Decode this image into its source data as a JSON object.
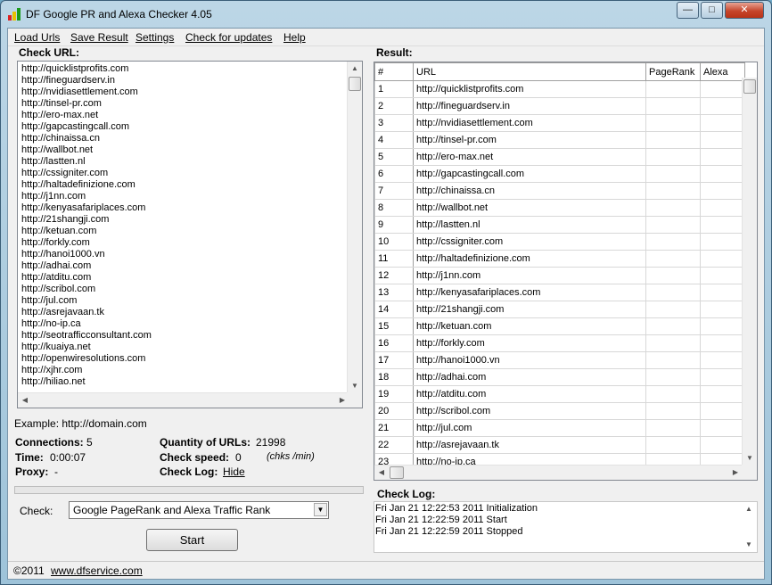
{
  "window": {
    "title": "DF Google PR and Alexa Checker 4.05"
  },
  "menu": [
    {
      "label": "Load Urls"
    },
    {
      "label": "Save Result"
    },
    {
      "label": "Settings"
    },
    {
      "label": "Check for updates"
    },
    {
      "label": "Help"
    }
  ],
  "check_url": {
    "label": "Check URL:",
    "urls": [
      "http://quicklistprofits.com",
      "http://fineguardserv.in",
      "http://nvidiasettlement.com",
      "http://tinsel-pr.com",
      "http://ero-max.net",
      "http://gapcastingcall.com",
      "http://chinaissa.cn",
      "http://wallbot.net",
      "http://lastten.nl",
      "http://cssigniter.com",
      "http://haltadefinizione.com",
      "http://j1nn.com",
      "http://kenyasafariplaces.com",
      "http://21shangji.com",
      "http://ketuan.com",
      "http://forkly.com",
      "http://hanoi1000.vn",
      "http://adhai.com",
      "http://atditu.com",
      "http://scribol.com",
      "http://jul.com",
      "http://asrejavaan.tk",
      "http://no-ip.ca",
      "http://seotrafficconsultant.com",
      "http://kuaiya.net",
      "http://openwiresolutions.com",
      "http://xjhr.com",
      "http://hiliao.net"
    ],
    "example": "Example: http://domain.com"
  },
  "stats": {
    "connections_label": "Connections:",
    "connections_value": "5",
    "time_label": "Time:",
    "time_value": "0:00:07",
    "proxy_label": "Proxy:",
    "proxy_value": "-",
    "quantity_label": "Quantity of URLs:",
    "quantity_value": "21998",
    "speed_label": "Check speed:",
    "speed_value": "0",
    "speed_unit": "(chks /min)",
    "log_label": "Check Log:",
    "log_link": "Hide"
  },
  "check": {
    "label": "Check:",
    "selected": "Google PageRank and Alexa Traffic Rank"
  },
  "start_button": "Start",
  "result": {
    "label": "Result:",
    "columns": [
      "#",
      "URL",
      "PageRank",
      "Alexa"
    ],
    "rows": [
      [
        "1",
        "http://quicklistprofits.com"
      ],
      [
        "2",
        "http://fineguardserv.in"
      ],
      [
        "3",
        "http://nvidiasettlement.com"
      ],
      [
        "4",
        "http://tinsel-pr.com"
      ],
      [
        "5",
        "http://ero-max.net"
      ],
      [
        "6",
        "http://gapcastingcall.com"
      ],
      [
        "7",
        "http://chinaissa.cn"
      ],
      [
        "8",
        "http://wallbot.net"
      ],
      [
        "9",
        "http://lastten.nl"
      ],
      [
        "10",
        "http://cssigniter.com"
      ],
      [
        "11",
        "http://haltadefinizione.com"
      ],
      [
        "12",
        "http://j1nn.com"
      ],
      [
        "13",
        "http://kenyasafariplaces.com"
      ],
      [
        "14",
        "http://21shangji.com"
      ],
      [
        "15",
        "http://ketuan.com"
      ],
      [
        "16",
        "http://forkly.com"
      ],
      [
        "17",
        "http://hanoi1000.vn"
      ],
      [
        "18",
        "http://adhai.com"
      ],
      [
        "19",
        "http://atditu.com"
      ],
      [
        "20",
        "http://scribol.com"
      ],
      [
        "21",
        "http://jul.com"
      ],
      [
        "22",
        "http://asrejavaan.tk"
      ],
      [
        "23",
        "http://no-ip.ca"
      ]
    ]
  },
  "check_log": {
    "label": "Check Log:",
    "lines": [
      "Fri Jan 21 12:22:53 2011 Initialization",
      "Fri Jan 21 12:22:59 2011 Start",
      "Fri Jan 21 12:22:59 2011 Stopped"
    ]
  },
  "status": {
    "copyright": "©2011",
    "link": "www.dfservice.com"
  },
  "colors": {
    "close_button": "#c6452b",
    "titlebar": "#bcd6e6"
  }
}
